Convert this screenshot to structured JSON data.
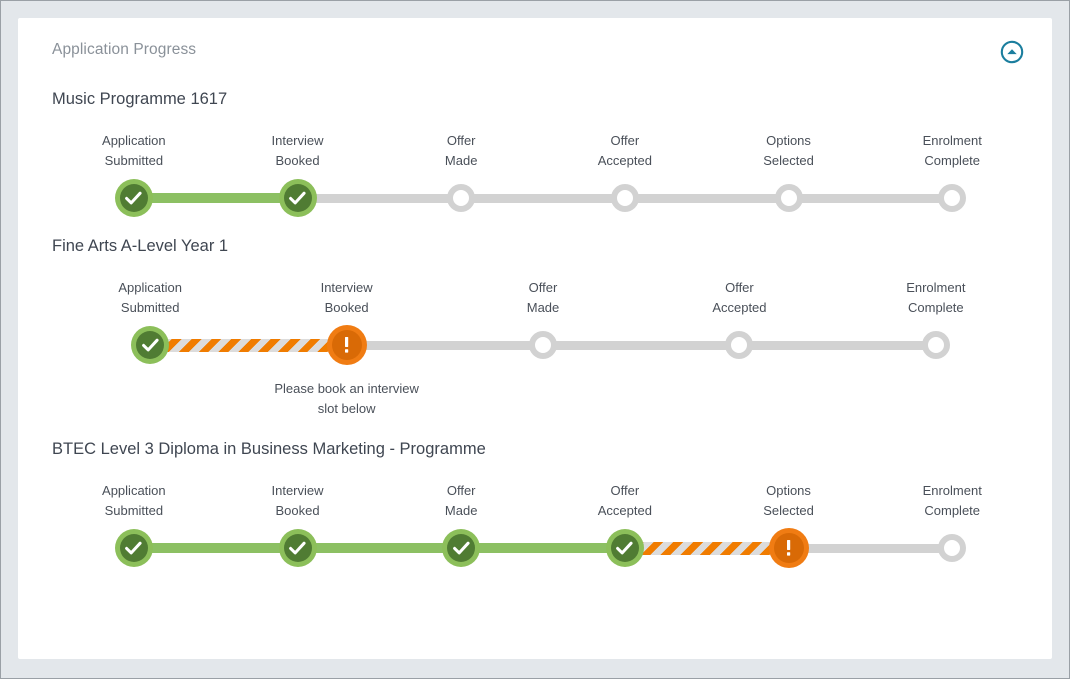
{
  "card": {
    "title": "Application Progress",
    "collapse_icon": "chevron-up-circle-icon",
    "collapse_icon_color": "#1b7e9e"
  },
  "colors": {
    "page_background": "#e3e7eb",
    "card_background": "#ffffff",
    "title_text": "#8a9199",
    "programme_title_text": "#3f4651",
    "step_label_text": "#4a5059",
    "bar_pending": "#d2d2d2",
    "bar_complete": "#8cc063",
    "bar_hatched_stripe": "#f07c00",
    "node_done_ring": "#8cbf5a",
    "node_done_fill": "#507c33",
    "node_warning_ring": "#f07c13",
    "node_warning_fill": "#d96a06",
    "node_pending_ring": "#d2d2d2"
  },
  "programmes": [
    {
      "title": "Music Programme 1617",
      "steps": [
        {
          "label": "Application\nSubmitted",
          "state": "done",
          "icon": "check-icon",
          "bar_after": "complete",
          "note": ""
        },
        {
          "label": "Interview\nBooked",
          "state": "done",
          "icon": "check-icon",
          "bar_after": "pending",
          "note": ""
        },
        {
          "label": "Offer\nMade",
          "state": "pending",
          "icon": "",
          "bar_after": "pending",
          "note": ""
        },
        {
          "label": "Offer\nAccepted",
          "state": "pending",
          "icon": "",
          "bar_after": "pending",
          "note": ""
        },
        {
          "label": "Options\nSelected",
          "state": "pending",
          "icon": "",
          "bar_after": "pending",
          "note": ""
        },
        {
          "label": "Enrolment\nComplete",
          "state": "pending",
          "icon": "",
          "bar_after": "none",
          "note": ""
        }
      ]
    },
    {
      "title": "Fine Arts A-Level Year 1",
      "steps": [
        {
          "label": "Application\nSubmitted",
          "state": "done",
          "icon": "check-icon",
          "bar_after": "hatched",
          "note": ""
        },
        {
          "label": "Interview\nBooked",
          "state": "warning",
          "icon": "exclamation-icon",
          "bar_after": "pending",
          "note": "Please book an interview\nslot below"
        },
        {
          "label": "Offer\nMade",
          "state": "pending",
          "icon": "",
          "bar_after": "pending",
          "note": ""
        },
        {
          "label": "Offer\nAccepted",
          "state": "pending",
          "icon": "",
          "bar_after": "pending",
          "note": ""
        },
        {
          "label": "Enrolment\nComplete",
          "state": "pending",
          "icon": "",
          "bar_after": "none",
          "note": ""
        }
      ]
    },
    {
      "title": "BTEC Level 3 Diploma in Business Marketing - Programme",
      "steps": [
        {
          "label": "Application\nSubmitted",
          "state": "done",
          "icon": "check-icon",
          "bar_after": "complete",
          "note": ""
        },
        {
          "label": "Interview\nBooked",
          "state": "done",
          "icon": "check-icon",
          "bar_after": "complete",
          "note": ""
        },
        {
          "label": "Offer\nMade",
          "state": "done",
          "icon": "check-icon",
          "bar_after": "complete",
          "note": ""
        },
        {
          "label": "Offer\nAccepted",
          "state": "done",
          "icon": "check-icon",
          "bar_after": "hatched",
          "note": ""
        },
        {
          "label": "Options\nSelected",
          "state": "warning",
          "icon": "exclamation-icon",
          "bar_after": "pending",
          "note": ""
        },
        {
          "label": "Enrolment\nComplete",
          "state": "pending",
          "icon": "",
          "bar_after": "none",
          "note": ""
        }
      ]
    }
  ]
}
